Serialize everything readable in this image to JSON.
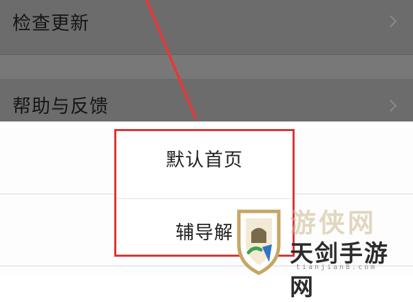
{
  "settings": {
    "items": [
      {
        "label": "检查更新"
      },
      {
        "label": "帮助与反馈"
      }
    ]
  },
  "popup": {
    "options": [
      {
        "label": "默认首页"
      },
      {
        "label": "辅导解"
      }
    ]
  },
  "watermark": {
    "name": "天剑手游网",
    "domain": "tianjian8.com"
  },
  "colors": {
    "annotation_red": "#d93434",
    "overlay_gray": "#6c6c6c"
  }
}
